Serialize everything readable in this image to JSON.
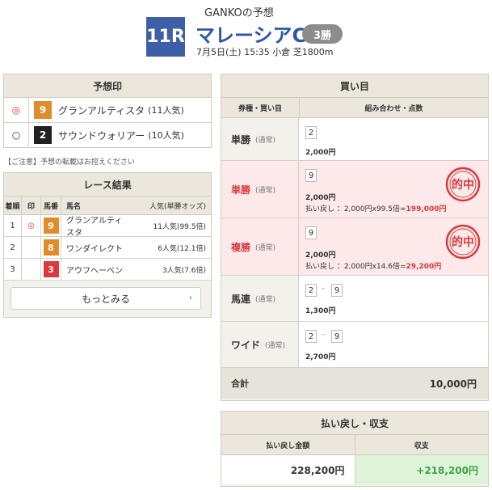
{
  "header": {
    "subtitle": "GANKOの予想",
    "race_number": "11R",
    "race_name": "マレーシアC",
    "grade": "3勝",
    "info": "7月5日(土) 15:35 小倉 芝1800m"
  },
  "prediction": {
    "title": "予想印",
    "items": [
      {
        "mark": "◎",
        "number": "9",
        "color": "#e08c2a",
        "name": "グランアルティスタ",
        "popularity": "(11人気)"
      },
      {
        "mark": "○",
        "number": "2",
        "color": "#222222",
        "name": "サウンドウォリアー",
        "popularity": "(10人気)"
      }
    ],
    "notice": "【ご注意】予想の転載はお控えください"
  },
  "result": {
    "title": "レース結果",
    "headers": [
      "着順",
      "印",
      "馬番",
      "馬名",
      "人気(単勝オッズ)"
    ],
    "rows": [
      {
        "rank": "1",
        "mark": "◎",
        "number": "9",
        "color": "#e08c2a",
        "name": "グランアルティスタ",
        "popularity": "11人気(99.5倍)"
      },
      {
        "rank": "2",
        "mark": "",
        "number": "8",
        "color": "#e08c2a",
        "name": "ワンダイレクト",
        "popularity": "6人気(12.1倍)"
      },
      {
        "rank": "3",
        "mark": "",
        "number": "3",
        "color": "#d9393c",
        "name": "アウフヘーベン",
        "popularity": "3人気(7.6倍)"
      }
    ],
    "more_label": "もっとみる",
    "more_icon": "chevron-right-icon"
  },
  "bets": {
    "title": "買い目",
    "headers": [
      "券種・買い目",
      "組み合わせ・点数"
    ],
    "rows": [
      {
        "type": "単勝",
        "sub": "(通常)",
        "picks": [
          "2"
        ],
        "amount": "2,000円",
        "hit": false
      },
      {
        "type": "単勝",
        "sub": "(通常)",
        "picks": [
          "9"
        ],
        "amount": "2,000円",
        "hit": true,
        "pay_prefix": "払い戻し ：2,000円x99.5倍=",
        "pay_value": "199,000円",
        "stamp": "的中"
      },
      {
        "type": "複勝",
        "sub": "(通常)",
        "picks": [
          "9"
        ],
        "amount": "2,000円",
        "hit": true,
        "pay_prefix": "払い戻し ：2,000円x14.6倍=",
        "pay_value": "29,200円",
        "stamp": "的中"
      },
      {
        "type": "馬連",
        "sub": "(通常)",
        "picks": [
          "2",
          "9"
        ],
        "amount": "1,300円",
        "hit": false
      },
      {
        "type": "ワイド",
        "sub": "(通常)",
        "picks": [
          "2",
          "9"
        ],
        "amount": "2,700円",
        "hit": false
      }
    ],
    "total_label": "合計",
    "total_value": "10,000円"
  },
  "summary": {
    "title": "払い戻し・収支",
    "headers": [
      "払い戻し金額",
      "収支"
    ],
    "payout": "228,200円",
    "profit": "+218,200円"
  },
  "colors": {
    "accent": "#2f56a8",
    "hit": "#d9393c",
    "profit": "#3aa54a"
  }
}
